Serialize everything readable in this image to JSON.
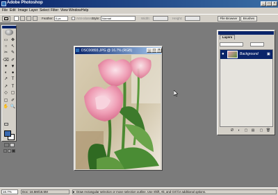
{
  "app": {
    "title": "Adobe Photoshop",
    "window_controls": {
      "minimize": "_",
      "maximize": "□",
      "close": "×"
    }
  },
  "menu": {
    "items": [
      "File",
      "Edit",
      "Image",
      "Layer",
      "Select",
      "Filter",
      "View",
      "Window",
      "Help"
    ]
  },
  "options_bar": {
    "feather_label": "Feather:",
    "feather_value": "0 px",
    "antialiased_label": "Anti-aliased",
    "style_label": "Style:",
    "style_value": "Normal",
    "width_label": "Width:",
    "height_label": "Height:",
    "file_browser_tab": "File Browser",
    "brushes_tab": "Brushes"
  },
  "toolbox": {
    "tools": [
      "▭",
      "✥",
      "○",
      "↖",
      "✂",
      "✎",
      "⌫",
      "✐",
      "✦",
      "▼",
      "◐",
      "●",
      "↗",
      "T",
      "◇",
      "▢",
      "✋",
      "🔍"
    ],
    "fg_color": "#3b6ab0",
    "bg_color": "#ffffff"
  },
  "document": {
    "title": "DSC00893.JPG @ 16.7% (RGB)"
  },
  "layers_panel": {
    "tab_label": "Layers",
    "layer_name": "Background",
    "icons": [
      "Ø",
      "◐",
      "▢",
      "▤",
      "🗑"
    ]
  },
  "status_bar": {
    "zoom": "16.7%",
    "doc_size": "Doc: 16.5M/16.5M",
    "hint": "Draw rectangular selection or move selection outline. Use Shift, Alt, and Ctrl for additional options."
  }
}
